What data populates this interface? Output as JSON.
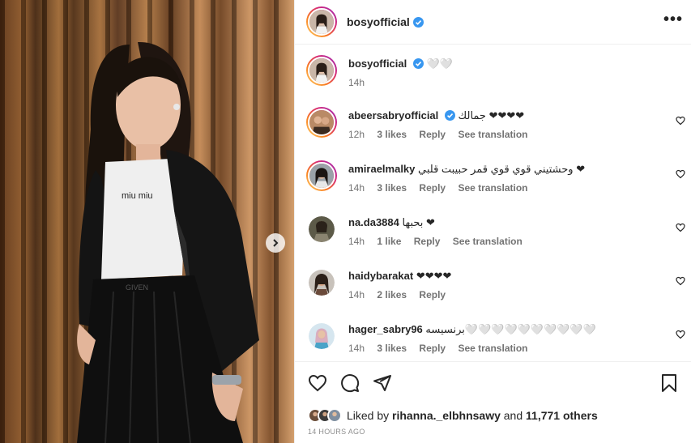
{
  "post": {
    "author": "bosyofficial",
    "caption": "🤍🤍",
    "caption_time": "14h"
  },
  "comments": [
    {
      "user": "abeersabryofficial",
      "text": "جمالك ❤❤❤❤",
      "time": "12h",
      "likes": "3 likes",
      "reply": "Reply",
      "translation": "See translation",
      "ring": true
    },
    {
      "user": "amiraelmalky",
      "text": "وحشتيني قوي قوي قمر حبيبت قلبي ❤",
      "time": "14h",
      "likes": "3 likes",
      "reply": "Reply",
      "translation": "See translation",
      "ring": true
    },
    {
      "user": "na.da3884",
      "text": "بحبها ❤",
      "time": "14h",
      "likes": "1 like",
      "reply": "Reply",
      "translation": "See translation",
      "ring": false
    },
    {
      "user": "haidybarakat",
      "text": "❤❤❤❤",
      "time": "14h",
      "likes": "2 likes",
      "reply": "Reply",
      "translation": "",
      "ring": false
    },
    {
      "user": "hager_sabry96",
      "text": "برنسيسه🤍🤍🤍🤍🤍🤍🤍🤍🤍🤍",
      "time": "14h",
      "likes": "3 likes",
      "reply": "Reply",
      "translation": "See translation",
      "ring": false
    }
  ],
  "likes": {
    "prefix": "Liked by",
    "user": "rihanna._elbhnsawy",
    "and": "and",
    "others": "11,771 others"
  },
  "timestamp": "14 HOURS AGO",
  "icons": {
    "more": "more-options-icon",
    "verified": "verified-badge-icon",
    "like": "heart-icon",
    "comment": "comment-icon",
    "share": "share-icon",
    "save": "bookmark-icon",
    "next": "chevron-right-icon"
  },
  "colors": {
    "verified": "#3897f0",
    "text": "#262626",
    "muted": "#737373",
    "ring_start": "#feda75",
    "ring_end": "#962fbf"
  }
}
